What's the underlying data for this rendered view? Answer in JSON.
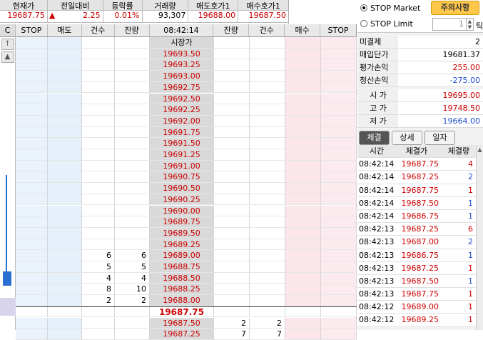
{
  "summary": {
    "headers": [
      "현재가",
      "전일대비",
      "등락률",
      "거래량",
      "매도호가1",
      "매수호가1"
    ],
    "current_price": "19687.75",
    "change_arrow": "▲",
    "change": "2.25",
    "rate": "0.01%",
    "volume": "93,307",
    "ask1": "19688.00",
    "bid1": "19687.50"
  },
  "grid": {
    "headers": [
      "STOP",
      "매도",
      "건수",
      "잔량",
      "08:42:14",
      "잔량",
      "건수",
      "매수",
      "STOP"
    ],
    "side_buttons": [
      "C",
      "↑",
      "▲"
    ],
    "market_label": "시장가",
    "current_row": "19687.75",
    "ask_rows": [
      {
        "price": "19693.50",
        "cnt": "",
        "qty": ""
      },
      {
        "price": "19693.25",
        "cnt": "",
        "qty": ""
      },
      {
        "price": "19693.00",
        "cnt": "",
        "qty": ""
      },
      {
        "price": "19692.75",
        "cnt": "",
        "qty": ""
      },
      {
        "price": "19692.50",
        "cnt": "",
        "qty": ""
      },
      {
        "price": "19692.25",
        "cnt": "",
        "qty": ""
      },
      {
        "price": "19692.00",
        "cnt": "",
        "qty": ""
      },
      {
        "price": "19691.75",
        "cnt": "",
        "qty": ""
      },
      {
        "price": "19691.50",
        "cnt": "",
        "qty": ""
      },
      {
        "price": "19691.25",
        "cnt": "",
        "qty": ""
      },
      {
        "price": "19691.00",
        "cnt": "",
        "qty": ""
      },
      {
        "price": "19690.75",
        "cnt": "",
        "qty": ""
      },
      {
        "price": "19690.50",
        "cnt": "",
        "qty": ""
      },
      {
        "price": "19690.25",
        "cnt": "",
        "qty": ""
      },
      {
        "price": "19690.00",
        "cnt": "",
        "qty": ""
      },
      {
        "price": "19689.75",
        "cnt": "",
        "qty": ""
      },
      {
        "price": "19689.50",
        "cnt": "",
        "qty": ""
      },
      {
        "price": "19689.25",
        "cnt": "",
        "qty": ""
      },
      {
        "price": "19689.00",
        "cnt": "6",
        "qty": "6"
      },
      {
        "price": "19688.75",
        "cnt": "5",
        "qty": "5"
      },
      {
        "price": "19688.50",
        "cnt": "4",
        "qty": "4"
      },
      {
        "price": "19688.25",
        "cnt": "8",
        "qty": "10"
      },
      {
        "price": "19688.00",
        "cnt": "2",
        "qty": "2"
      }
    ],
    "bid_rows": [
      {
        "price": "19687.50",
        "qty": "2",
        "cnt": "2"
      },
      {
        "price": "19687.25",
        "qty": "7",
        "cnt": "7"
      }
    ]
  },
  "right": {
    "stop_market": "STOP Market",
    "stop_limit": "STOP Limit",
    "notice_button": "주의사항",
    "tick_value": "1",
    "tick_label": "틱",
    "position": [
      {
        "k": "미결제",
        "v": "2",
        "color": "#000000"
      },
      {
        "k": "매입단가",
        "v": "19681.37",
        "color": "#000000"
      },
      {
        "k": "평가손익",
        "v": "255.00",
        "color": "#cc0000"
      },
      {
        "k": "청산손익",
        "v": "-275.00",
        "color": "#1f4fcf"
      }
    ],
    "ohl": [
      {
        "k": "시 가",
        "v": "19695.00",
        "color": "#cc0000"
      },
      {
        "k": "고 가",
        "v": "19748.50",
        "color": "#cc0000"
      },
      {
        "k": "저 가",
        "v": "19664.00",
        "color": "#1f4fcf"
      }
    ],
    "tabs": [
      "체결",
      "상세",
      "일자"
    ],
    "trade_headers": [
      "시간",
      "체결가",
      "체결량"
    ],
    "trades": [
      {
        "t": "08:42:14",
        "p": "19687.75",
        "q": "4",
        "qc": "#cc0000"
      },
      {
        "t": "08:42:14",
        "p": "19687.25",
        "q": "2",
        "qc": "#1f4fcf"
      },
      {
        "t": "08:42:14",
        "p": "19687.75",
        "q": "1",
        "qc": "#cc0000"
      },
      {
        "t": "08:42:14",
        "p": "19687.50",
        "q": "1",
        "qc": "#1f4fcf"
      },
      {
        "t": "08:42:14",
        "p": "19686.75",
        "q": "1",
        "qc": "#1f4fcf"
      },
      {
        "t": "08:42:13",
        "p": "19687.25",
        "q": "6",
        "qc": "#cc0000"
      },
      {
        "t": "08:42:13",
        "p": "19687.00",
        "q": "2",
        "qc": "#1f4fcf"
      },
      {
        "t": "08:42:13",
        "p": "19686.75",
        "q": "1",
        "qc": "#1f4fcf"
      },
      {
        "t": "08:42:13",
        "p": "19687.25",
        "q": "1",
        "qc": "#cc0000"
      },
      {
        "t": "08:42:13",
        "p": "19687.50",
        "q": "1",
        "qc": "#1f4fcf"
      },
      {
        "t": "08:42:13",
        "p": "19687.75",
        "q": "1",
        "qc": "#cc0000"
      },
      {
        "t": "08:42:12",
        "p": "19689.00",
        "q": "1",
        "qc": "#cc0000"
      },
      {
        "t": "08:42:12",
        "p": "19689.25",
        "q": "1",
        "qc": "#cc0000"
      }
    ]
  }
}
